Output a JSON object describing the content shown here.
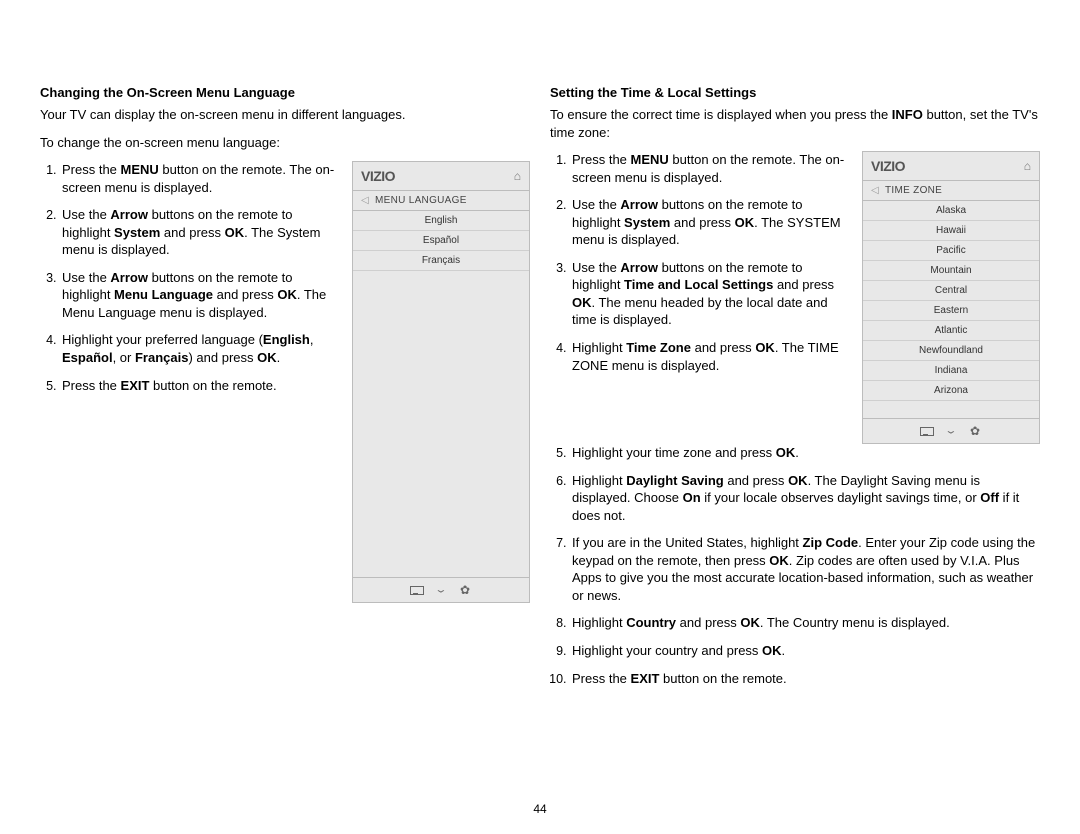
{
  "page_number": "44",
  "left": {
    "heading": "Changing the On-Screen Menu Language",
    "intro": "Your TV can display the on-screen menu in different languages.",
    "lead": "To change the on-screen menu language:",
    "steps_html": [
      "Press the <b>MENU</b> button on the remote. The on-screen menu is displayed.",
      "Use the <b>Arrow</b> buttons on the remote to highlight <b>System</b> and press <b>OK</b>. The System menu is displayed.",
      "Use the <b>Arrow</b> buttons on the remote to highlight <b>Menu Language</b> and press <b>OK</b>. The Menu Language menu is displayed.",
      "Highlight your preferred language (<b>English</b>, <b>Español</b>, or <b>Français</b>) and press <b>OK</b>.",
      "Press the <b>EXIT</b> button on the remote."
    ],
    "widget": {
      "brand": "VIZIO",
      "crumb": "MENU LANGUAGE",
      "rows": [
        "English",
        "Español",
        "Français"
      ]
    }
  },
  "right": {
    "heading": "Setting the Time & Local Settings",
    "intro_html": "To ensure the correct time is displayed when you press the <b>INFO</b> button, set the TV's time zone:",
    "steps_top_html": [
      "Press the <b>MENU</b> button on the remote. The on-screen menu is displayed.",
      "Use the <b>Arrow</b> buttons on the remote to highlight <b>System</b> and press <b>OK</b>. The SYSTEM menu is displayed.",
      "Use the <b>Arrow</b> buttons on the remote to highlight <b>Time and Local Settings</b> and press <b>OK</b>. The menu headed by the local date and time is displayed.",
      "Highlight <b>Time Zone</b> and press <b>OK</b>. The TIME ZONE menu is displayed."
    ],
    "steps_bottom_html": [
      "Highlight your time zone and press <b>OK</b>.",
      "Highlight <b>Daylight Saving</b> and press <b>OK</b>. The Daylight Saving menu is displayed. Choose <b>On</b> if your locale observes daylight savings time, or <b>Off</b> if it does not.",
      "If you are in the United States, highlight <b>Zip Code</b>. Enter your Zip code using the keypad on the remote, then press <b>OK</b>. Zip codes are often used by V.I.A. Plus Apps to give you the most accurate location-based information, such as weather or news.",
      "Highlight <b>Country</b> and press <b>OK</b>. The Country menu is displayed.",
      "Highlight your country and press <b>OK</b>.",
      "Press the <b>EXIT</b> button on the remote."
    ],
    "widget": {
      "brand": "VIZIO",
      "crumb": "TIME ZONE",
      "rows": [
        "Alaska",
        "Hawaii",
        "Pacific",
        "Mountain",
        "Central",
        "Eastern",
        "Atlantic",
        "Newfoundland",
        "Indiana",
        "Arizona"
      ]
    }
  }
}
